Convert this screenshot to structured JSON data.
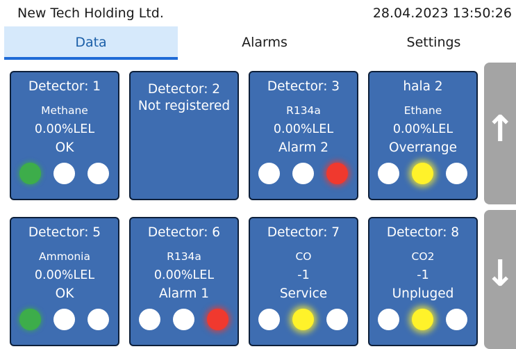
{
  "header": {
    "company": "New Tech Holding Ltd.",
    "datetime": "28.04.2023 13:50:26"
  },
  "tabs": [
    {
      "label": "Data",
      "active": true
    },
    {
      "label": "Alarms",
      "active": false
    },
    {
      "label": "Settings",
      "active": false
    }
  ],
  "detectors": [
    {
      "title": "Detector: 1",
      "gas": "Methane",
      "value": "0.00%LEL",
      "state": "OK",
      "leds": [
        "green",
        "white",
        "white"
      ]
    },
    {
      "title": "Detector: 2",
      "not_registered": "Not registered",
      "leds": []
    },
    {
      "title": "Detector: 3",
      "gas": "R134a",
      "value": "0.00%LEL",
      "state": "Alarm 2",
      "leds": [
        "white",
        "white",
        "red"
      ]
    },
    {
      "title": "hala 2",
      "gas": "Ethane",
      "value": "0.00%LEL",
      "state": "Overrange",
      "leds": [
        "white",
        "yellow",
        "white"
      ]
    },
    {
      "title": "Detector: 5",
      "gas": "Ammonia",
      "value": "0.00%LEL",
      "state": "OK",
      "leds": [
        "green",
        "white",
        "white"
      ]
    },
    {
      "title": "Detector: 6",
      "gas": "R134a",
      "value": "0.00%LEL",
      "state": "Alarm 1",
      "leds": [
        "white",
        "white",
        "red"
      ]
    },
    {
      "title": "Detector: 7",
      "gas": "CO",
      "value": "-1",
      "state": "Service",
      "leds": [
        "white",
        "yellow",
        "white"
      ]
    },
    {
      "title": "Detector: 8",
      "gas": "CO2",
      "value": "-1",
      "state": "Unpluged",
      "leds": [
        "white",
        "yellow",
        "white"
      ]
    }
  ],
  "scroll": {
    "up_icon": "arrow-up-icon",
    "down_icon": "arrow-down-icon"
  },
  "colors": {
    "card": "#3e6db1",
    "tab_active": "#d6e9fb",
    "scroll": "#a4a4a4",
    "led_green": "#3dad4a",
    "led_yellow": "#fff22a",
    "led_red": "#f0392e"
  }
}
